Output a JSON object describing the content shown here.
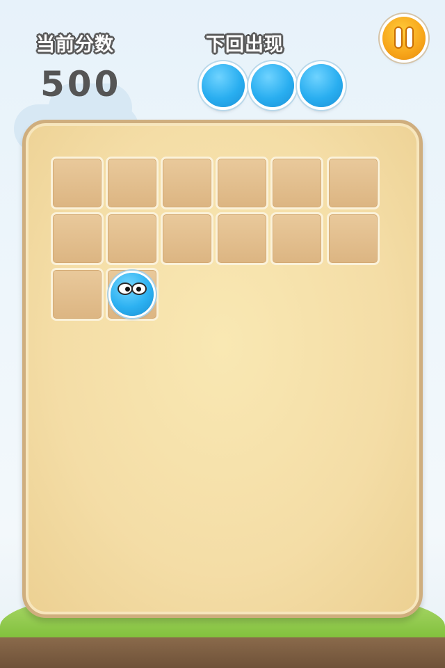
{
  "hud": {
    "score_label": "当前分数",
    "score_value": "500",
    "next_label": "下回出现",
    "next_balls": [
      {
        "color": "blue"
      },
      {
        "color": "blue"
      },
      {
        "color": "blue"
      }
    ]
  },
  "pause_button": {
    "icon": "pause-icon"
  },
  "board": {
    "columns": 6,
    "filled_cells": 13,
    "ball": {
      "row": 3,
      "column": 2,
      "color": "blue"
    }
  },
  "colors": {
    "ball_blue": "#2cb1f1",
    "pause_orange": "#f7a51a",
    "board_fill": "#f4dda6"
  }
}
